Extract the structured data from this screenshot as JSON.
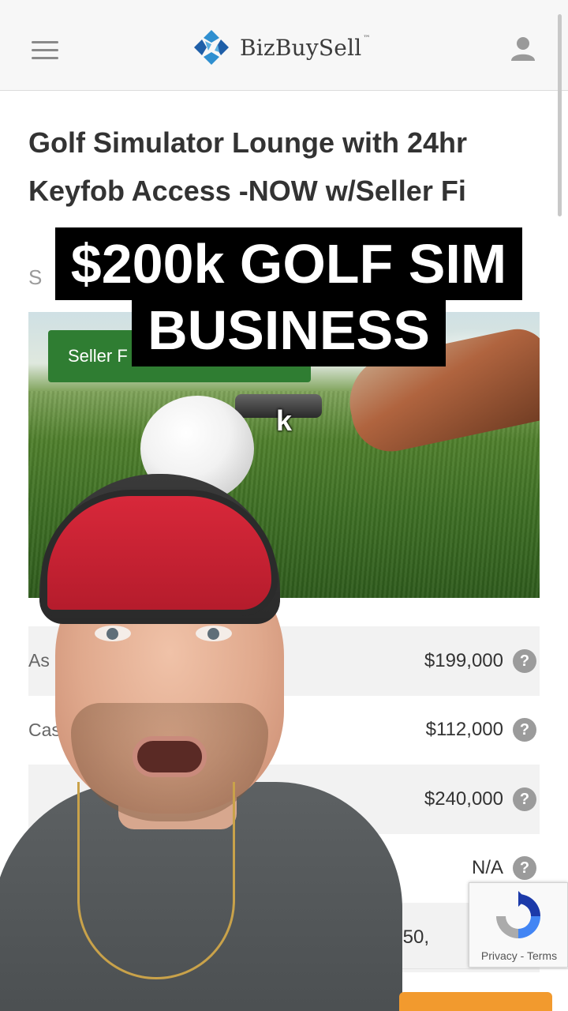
{
  "header": {
    "brand": "BizBuySell",
    "trademark": "™",
    "menu_icon": "hamburger-menu-icon",
    "user_icon": "user-account-icon",
    "brand_colors": {
      "blue": "#2f8fd0",
      "dark_blue": "#1f5fa8",
      "text": "#3b3b3b"
    }
  },
  "listing": {
    "title": "Golf Simulator Lounge with 24hr Keyfob Access -NOW w/Seller Fi",
    "subtitle_fragment": "S",
    "badge": "Seller F"
  },
  "overlay": {
    "caption_line1": "$200k GOLF SIM",
    "caption_line2": "BUSINESS",
    "small_caption": "k"
  },
  "financials": [
    {
      "label": "As",
      "value": "$199,000"
    },
    {
      "label": "Cash",
      "value": "$112,000"
    },
    {
      "label": "",
      "value": "$240,000"
    },
    {
      "label": "",
      "value": "N/A"
    },
    {
      "label": "",
      "value": "$150,"
    }
  ],
  "help_icon": "question-mark-icon",
  "help_glyph": "?",
  "recaptcha": {
    "privacy": "Privacy",
    "separator": " - ",
    "terms": "Terms"
  },
  "colors": {
    "badge_green": "#2f7d32",
    "row_shade": "#f2f2f2",
    "cta_orange": "#f29a2e"
  }
}
